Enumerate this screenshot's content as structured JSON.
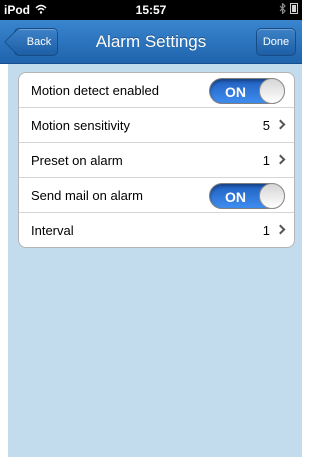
{
  "status_bar": {
    "carrier": "iPod",
    "time": "15:57",
    "icons": [
      "wifi-icon",
      "bluetooth-icon",
      "battery-icon"
    ]
  },
  "nav": {
    "title": "Alarm Settings",
    "back_label": "Back",
    "done_label": "Done"
  },
  "settings": {
    "rows": [
      {
        "label": "Motion detect enabled",
        "type": "toggle",
        "toggle_label": "ON",
        "checked": true
      },
      {
        "label": "Motion sensitivity",
        "type": "value",
        "value": "5"
      },
      {
        "label": "Preset on alarm",
        "type": "value",
        "value": "1"
      },
      {
        "label": "Send mail on alarm",
        "type": "toggle",
        "toggle_label": "ON",
        "checked": true
      },
      {
        "label": "Interval",
        "type": "value",
        "value": "1"
      }
    ]
  },
  "colors": {
    "nav": "#2a72bb",
    "background": "#c3dced",
    "toggle_on": "#2f7de0"
  }
}
